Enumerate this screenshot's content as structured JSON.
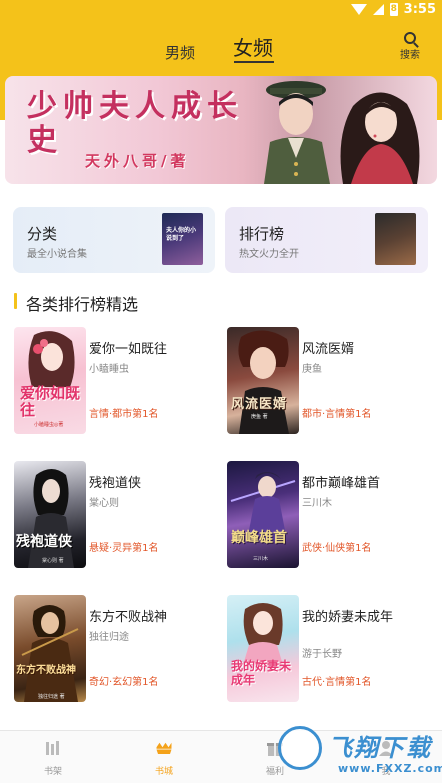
{
  "status_bar": {
    "time": "3:55",
    "battery_glyph": "8"
  },
  "header": {
    "tabs": [
      {
        "label": "男频",
        "active": false
      },
      {
        "label": "女频",
        "active": true
      }
    ],
    "search_label": "搜索",
    "accent_color": "#f4c21a"
  },
  "banner": {
    "title": "少帅夫人成长史",
    "author": "天外八哥/著"
  },
  "cards": [
    {
      "title": "分类",
      "subtitle": "最全小说合集",
      "cover_text": "夫人你的小说到了"
    },
    {
      "title": "排行榜",
      "subtitle": "热文火力全开",
      "cover_text": ""
    }
  ],
  "section": {
    "title": "各类排行榜精选"
  },
  "books": [
    {
      "title": "爱你一如既往",
      "author": "小瞌睡虫",
      "tag": "言情·都市第1名",
      "cover_text": "爱你如既往",
      "cover_small": "小瞌睡虫◎著"
    },
    {
      "title": "风流医婿",
      "author": "庚鱼",
      "tag": "都市·言情第1名",
      "cover_text": "风流医婿",
      "cover_small": "庚鱼 著"
    },
    {
      "title": "残袍道侠",
      "author": "棠心则",
      "tag": "悬疑·灵异第1名",
      "cover_text": "残袍道侠",
      "cover_small": "棠心则 著"
    },
    {
      "title": "都市巅峰雄首",
      "author": "三川木",
      "tag": "武侠·仙侠第1名",
      "cover_text": "巅峰雄首",
      "cover_small": "三川木"
    },
    {
      "title": "东方不败战神",
      "author": "独往归途",
      "tag": "奇幻·玄幻第1名",
      "cover_text": "东方不败战神",
      "cover_small": "独往归途 著"
    },
    {
      "title": "我的娇妻未成年",
      "author": "游于长野",
      "tag": "古代·言情第1名",
      "cover_text": "我的娇妻未成年",
      "cover_small": ""
    }
  ],
  "bottom_nav": [
    {
      "label": "书架",
      "icon": "bookshelf-icon",
      "active": false
    },
    {
      "label": "书城",
      "icon": "bookstore-icon",
      "active": true
    },
    {
      "label": "福利",
      "icon": "gift-icon",
      "active": false
    },
    {
      "label": "我",
      "icon": "profile-icon",
      "active": false
    }
  ],
  "watermark": {
    "text": "飞翔下载",
    "url": "www.FXXZ.com"
  }
}
